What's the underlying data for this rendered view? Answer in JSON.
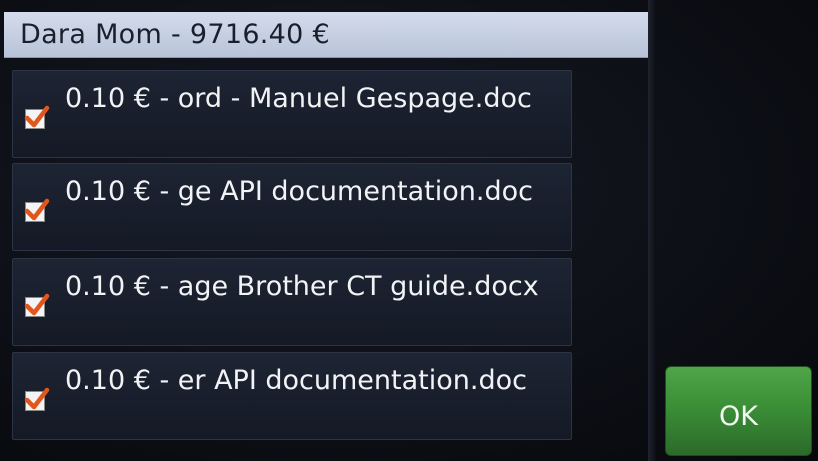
{
  "header": {
    "title": "Dara Mom - 9716.40 €"
  },
  "jobs": [
    {
      "label": "0.10 € - ord - Manuel Gespage.doc",
      "checked": true
    },
    {
      "label": "0.10 € - ge API documentation.doc",
      "checked": true
    },
    {
      "label": "0.10 € - age Brother CT guide.docx",
      "checked": true
    },
    {
      "label": "0.10 € - er API documentation.doc",
      "checked": true
    }
  ],
  "actions": {
    "ok_label": "OK"
  },
  "colors": {
    "checkmark": "#e0561c",
    "ok_button": "#3b8f37",
    "title_bar": "#c8d1e4"
  }
}
